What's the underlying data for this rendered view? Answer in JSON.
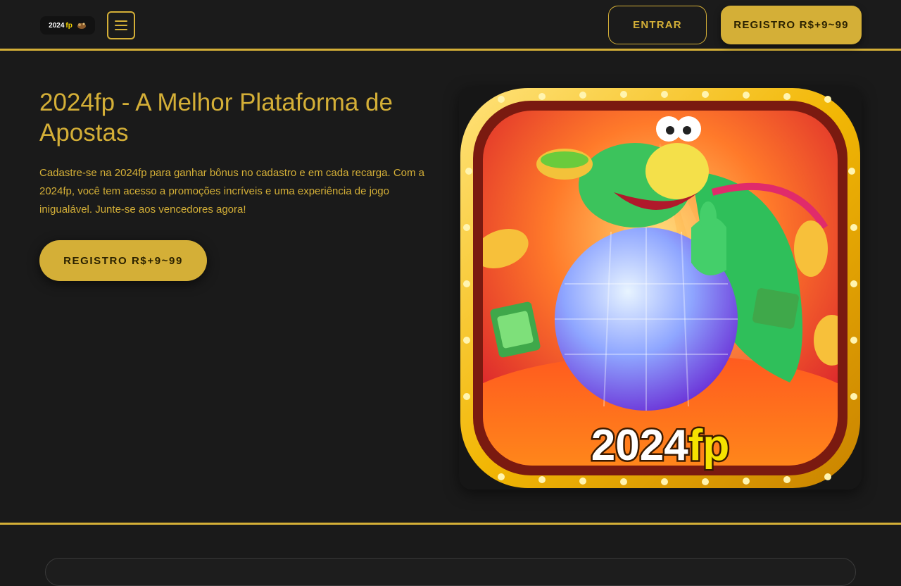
{
  "header": {
    "logo_text": "2024",
    "logo_accent": "fp",
    "menu_icon": "hamburger-menu-icon",
    "login_label": "ENTRAR",
    "register_label": "REGISTRO R$+9~99"
  },
  "hero": {
    "title": "2024fp - A Melhor Plataforma de Apostas",
    "description": "Cadastre-se na 2024fp para ganhar bônus no cadastro e em cada recarga. Com a 2024fp, você tem acesso a promoções incríveis e uma experiência de jogo inigualável. Junte-se aos vencedores agora!",
    "cta_label": "REGISTRO R$+9~99",
    "image_brand_text": "2024",
    "image_brand_accent": "fp"
  },
  "colors": {
    "accent": "#d4af37",
    "background": "#1a1a1a"
  }
}
